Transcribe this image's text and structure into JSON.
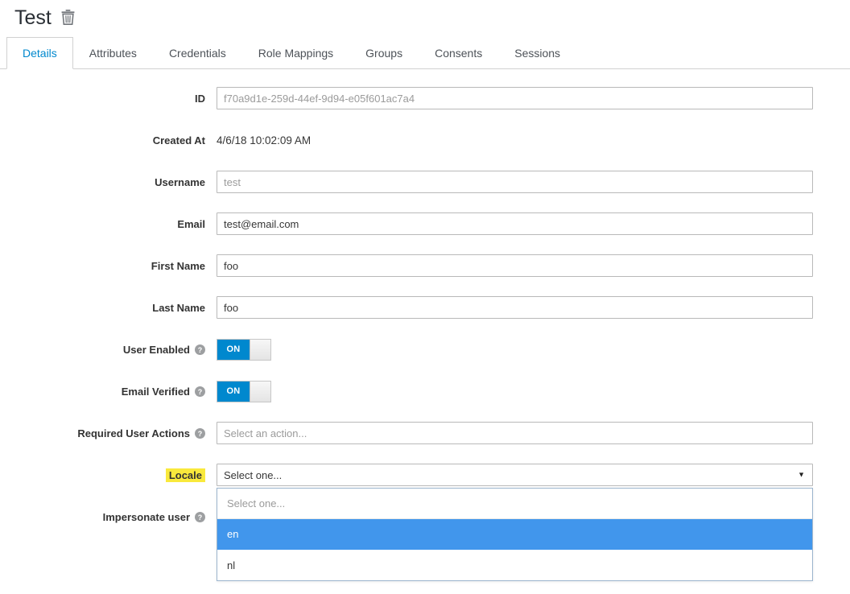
{
  "header": {
    "title": "Test"
  },
  "tabs": [
    {
      "label": "Details",
      "active": true
    },
    {
      "label": "Attributes",
      "active": false
    },
    {
      "label": "Credentials",
      "active": false
    },
    {
      "label": "Role Mappings",
      "active": false
    },
    {
      "label": "Groups",
      "active": false
    },
    {
      "label": "Consents",
      "active": false
    },
    {
      "label": "Sessions",
      "active": false
    }
  ],
  "form": {
    "id": {
      "label": "ID",
      "value": "f70a9d1e-259d-44ef-9d94-e05f601ac7a4"
    },
    "created_at": {
      "label": "Created At",
      "value": "4/6/18 10:02:09 AM"
    },
    "username": {
      "label": "Username",
      "value": "test"
    },
    "email": {
      "label": "Email",
      "value": "test@email.com"
    },
    "first_name": {
      "label": "First Name",
      "value": "foo"
    },
    "last_name": {
      "label": "Last Name",
      "value": "foo"
    },
    "user_enabled": {
      "label": "User Enabled",
      "state": "ON"
    },
    "email_verified": {
      "label": "Email Verified",
      "state": "ON"
    },
    "required_user_actions": {
      "label": "Required User Actions",
      "placeholder": "Select an action..."
    },
    "locale": {
      "label": "Locale",
      "value": "Select one...",
      "options": [
        "Select one...",
        "en",
        "nl"
      ],
      "highlighted_option": "en"
    },
    "impersonate_user": {
      "label": "Impersonate user"
    }
  },
  "colors": {
    "accent": "#0088ce",
    "toggle_on": "#0088ce",
    "label_highlight": "#f9e93c",
    "dropdown_highlight": "#4196ec"
  }
}
